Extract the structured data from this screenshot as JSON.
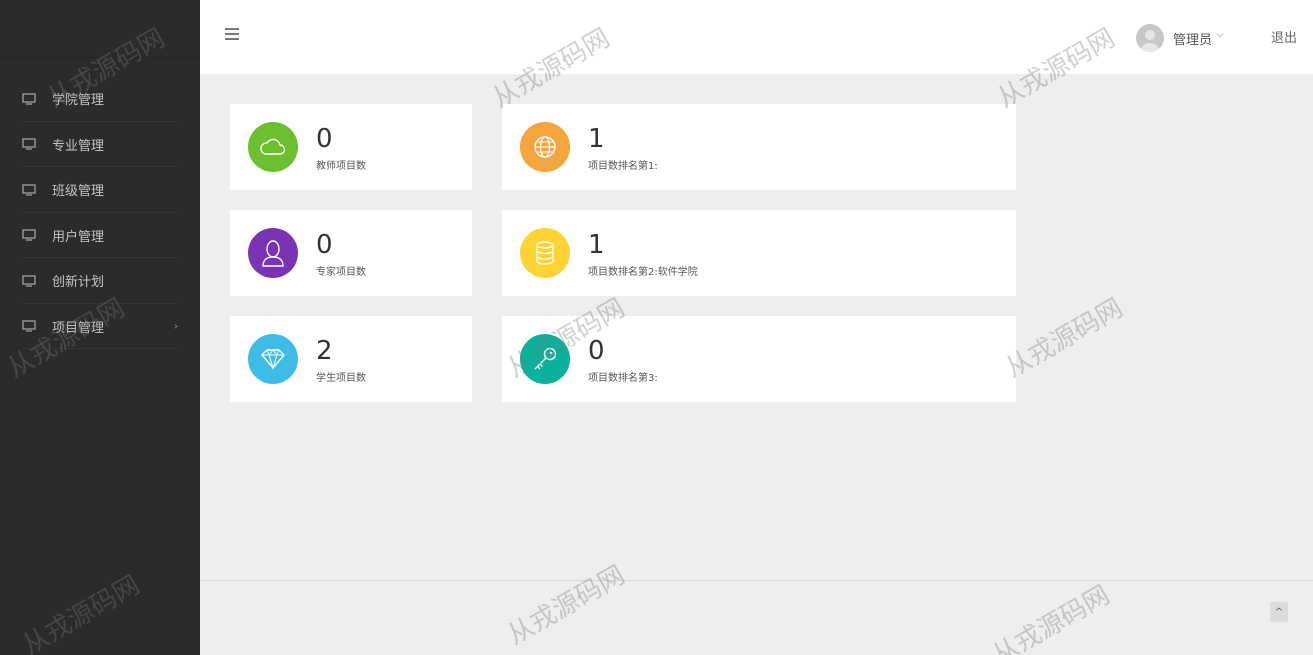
{
  "sidebar": {
    "items": [
      {
        "label": "学院管理",
        "icon": "monitor-icon"
      },
      {
        "label": "专业管理",
        "icon": "monitor-icon"
      },
      {
        "label": "班级管理",
        "icon": "monitor-icon"
      },
      {
        "label": "用户管理",
        "icon": "monitor-icon"
      },
      {
        "label": "创新计划",
        "icon": "monitor-icon"
      },
      {
        "label": "项目管理",
        "icon": "monitor-icon",
        "arrow": "›"
      }
    ]
  },
  "header": {
    "menu_icon": "hamburger-icon",
    "user_name": "管理员",
    "user_caret": "⌵",
    "logout": "退出"
  },
  "stats": [
    {
      "value": "0",
      "label": "教师项目数",
      "icon": "cloud-icon",
      "color": "#6cbf2f"
    },
    {
      "value": "0",
      "label": "专家项目数",
      "icon": "user-icon",
      "color": "#7b33b6"
    },
    {
      "value": "2",
      "label": "学生项目数",
      "icon": "diamond-icon",
      "color": "#3dbce8"
    },
    {
      "value": "1",
      "label": "项目数排名第1:",
      "icon": "globe-icon",
      "color": "#f5a53d"
    },
    {
      "value": "1",
      "label": "项目数排名第2:软件学院",
      "icon": "database-icon",
      "color": "#fed333"
    },
    {
      "value": "0",
      "label": "项目数排名第3:",
      "icon": "key-icon",
      "color": "#0ab19b"
    }
  ],
  "footer": {
    "back_to_top": "^"
  },
  "watermark": "从戎源码网"
}
